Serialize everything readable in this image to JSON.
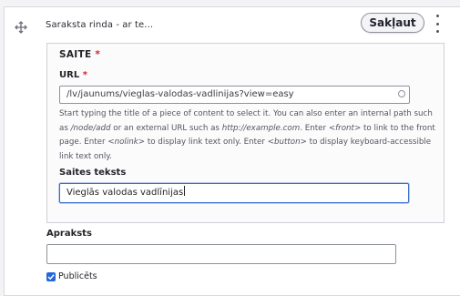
{
  "row": {
    "title": "Saraksta rinda - ar te...",
    "collapse_label": "Sakļaut"
  },
  "fieldset": {
    "legend": "SAITE",
    "required_mark": "*",
    "url": {
      "label": "URL",
      "required_mark": "*",
      "value": "/lv/jaunums/vieglas-valodas-vadlinijas?view=easy"
    },
    "description": {
      "part1": "Start typing the title of a piece of content to select it. You can also enter an internal path such as ",
      "em1": "/node/add",
      "part2": " or an external URL such as ",
      "em2": "http://example.com",
      "part3": ". Enter ",
      "em3": "<front>",
      "part4": " to link to the front page. Enter ",
      "em4": "<nolink>",
      "part5": " to display link text only. Enter ",
      "em5": "<button>",
      "part6": " to display keyboard-accessible link text only."
    },
    "link_text": {
      "label": "Saites teksts",
      "value": "Vieglās valodas vadlīnijas"
    }
  },
  "description_field": {
    "label": "Apraksts",
    "value": ""
  },
  "published": {
    "label": "Publicēts",
    "checked": true
  },
  "colors": {
    "accent": "#2567d8",
    "required": "#d72222"
  }
}
